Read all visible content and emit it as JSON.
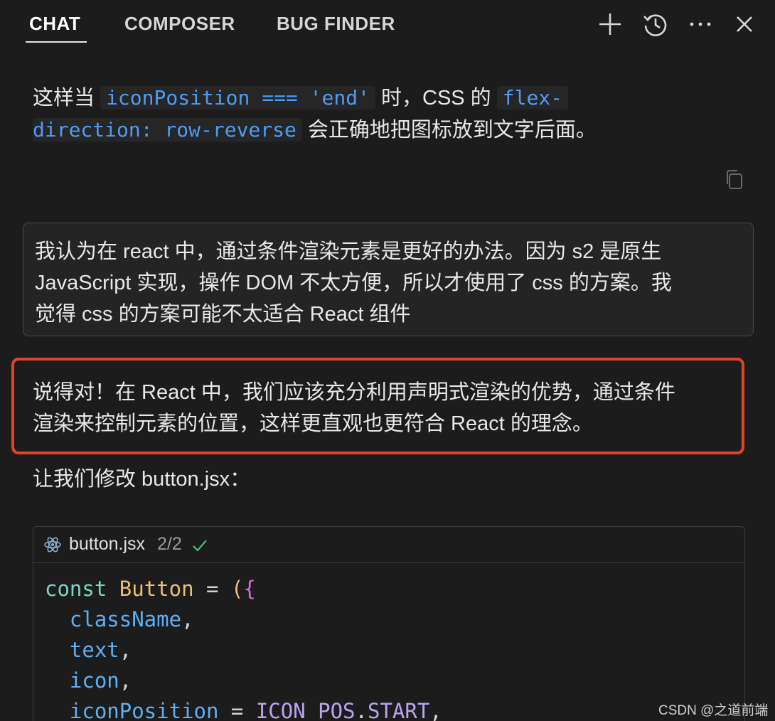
{
  "tabs": [
    {
      "label": "CHAT",
      "active": true
    },
    {
      "label": "COMPOSER",
      "active": false
    },
    {
      "label": "BUG FINDER",
      "active": false
    }
  ],
  "header_icons": [
    "plus-icon",
    "history-icon",
    "more-icon",
    "close-icon"
  ],
  "assistant_prev": {
    "t1": "这样当 ",
    "code1": "iconPosition === 'end'",
    "t2": " 时，CSS 的 ",
    "code2a": "flex-",
    "code2b": "direction: row-reverse",
    "t3": " 会正确地把图标放到文字后面。"
  },
  "user_message": {
    "line1": "我认为在 react 中，通过条件渲染元素是更好的办法。因为 s2 是原生",
    "line2": "JavaScript 实现，操作 DOM 不太方便，所以才使用了 css 的方案。我",
    "line3": "觉得 css 的方案可能不太适合 React 组件"
  },
  "assistant_reply": {
    "line1": "说得对！在 React 中，我们应该充分利用声明式渲染的优势，通过条件",
    "line2": "渲染来控制元素的位置，这样更直观也更符合 React 的理念。",
    "lead": "让我们修改 button.jsx："
  },
  "code_block": {
    "file_name": "button.jsx",
    "count": "2/2",
    "kw_const": "const",
    "fn_name": "Button",
    "eq": " = ",
    "open_paren": "(",
    "open_brace": "{",
    "p1": "className",
    "p2": "text",
    "p3": "icon",
    "p4": "iconPosition",
    "p4_eq": " = ",
    "p4_const": "ICON_POS",
    "p4_dot": ".",
    "p4_prop": "START",
    "comma": ","
  },
  "watermark": "CSDN @之道前端",
  "colors": {
    "background": "#1c1c1c",
    "highlight_border": "#e5422a",
    "inline_code": "#4e9cf5"
  }
}
